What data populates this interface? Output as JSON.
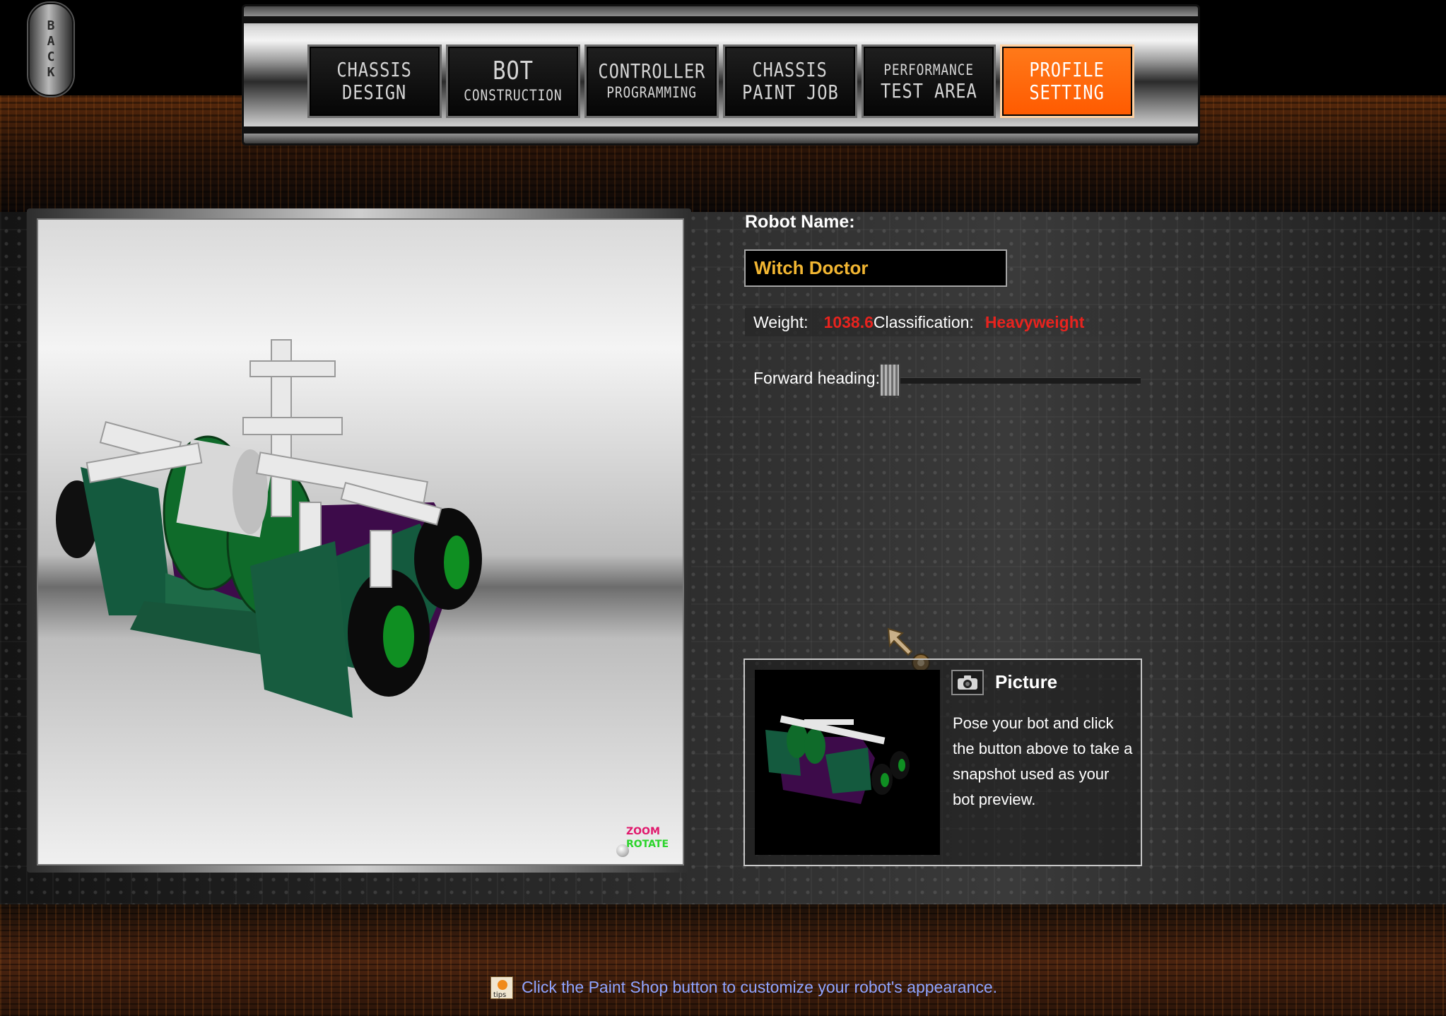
{
  "nav": {
    "back_label": "BACK",
    "back_letters": [
      "B",
      "A",
      "C",
      "K"
    ],
    "tabs": [
      {
        "line1": "CHASSIS",
        "line2": "DESIGN",
        "active": false
      },
      {
        "line1": "BOT",
        "line2": "CONSTRUCTION",
        "active": false
      },
      {
        "line1": "CONTROLLER",
        "line2": "PROGRAMMING",
        "active": false
      },
      {
        "line1": "CHASSIS",
        "line2": "PAINT JOB",
        "active": false
      },
      {
        "line1": "PERFORMANCE",
        "line2": "TEST AREA",
        "active": false
      },
      {
        "line1": "PROFILE",
        "line2": "SETTING",
        "active": true
      }
    ]
  },
  "viewport": {
    "zoom_label": "ZOOM",
    "rotate_label": "ROTATE"
  },
  "profile": {
    "robot_name_label": "Robot Name:",
    "robot_name_value": "Witch Doctor",
    "weight_label": "Weight:",
    "weight_value": "1038.6",
    "classification_label": "Classification:",
    "classification_value": "Heavyweight",
    "forward_heading_label": "Forward heading:"
  },
  "picture": {
    "title": "Picture",
    "description": "Pose your bot and click the button above to take a snapshot used as your bot preview.",
    "camera_icon": "camera-icon"
  },
  "tip": {
    "icon": "tips-icon",
    "icon_text": "tips",
    "text": "Click the Paint Shop button to customize your robot's appearance."
  },
  "colors": {
    "active_tab": "#ff5a00",
    "robot_name": "#f2b632",
    "stat_value": "#e8231e",
    "tip_text": "#8fa4ff",
    "zoom": "#e0186c",
    "rotate": "#2ad42a"
  }
}
